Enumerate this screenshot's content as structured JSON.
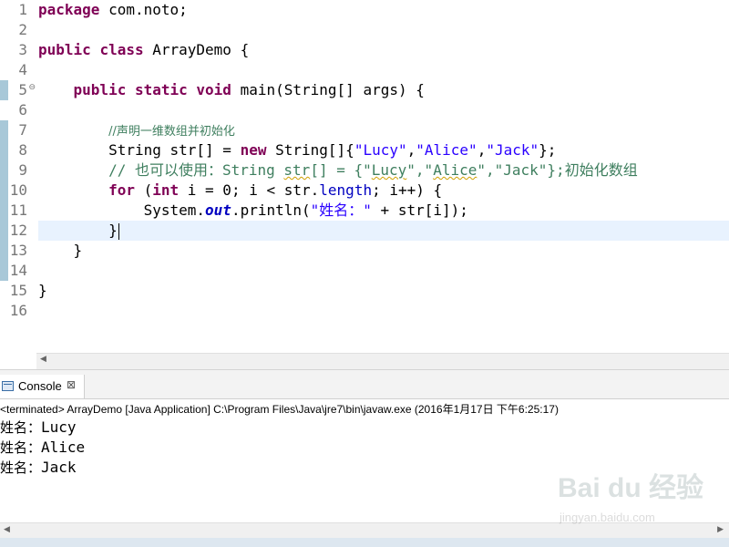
{
  "editor": {
    "line_numbers": [
      "1",
      "2",
      "3",
      "4",
      "5",
      "6",
      "7",
      "8",
      "9",
      "10",
      "11",
      "12",
      "13",
      "14",
      "15",
      "16"
    ],
    "lines": {
      "l1": {
        "kw": "package",
        "rest": " com.noto;"
      },
      "l3": {
        "kw1": "public",
        "kw2": "class",
        "rest": " ArrayDemo {"
      },
      "l5": {
        "indent": "    ",
        "kw1": "public",
        "kw2": "static",
        "kw3": "void",
        "rest": " main(String[] ",
        "param": "args",
        "end": ") {"
      },
      "l7": {
        "indent": "        ",
        "comment": "//声明一维数组并初始化"
      },
      "l8": {
        "indent": "        ",
        "a": "String ",
        "var": "str",
        "b": "[] = ",
        "kw": "new",
        "c": " String[]{",
        "s1": "\"Lucy\"",
        "comma1": ",",
        "s2": "\"Alice\"",
        "comma2": ",",
        "s3": "\"Jack\"",
        "end": "};"
      },
      "l9": {
        "indent": "        ",
        "c1": "// 也可以使用：String ",
        "var": "str",
        "c2": "[] = {\"",
        "w1": "Lucy",
        "c3": "\",\"",
        "w2": "Alice",
        "c4": "\",\"Jack\"};初始化数组"
      },
      "l10": {
        "indent": "        ",
        "kw1": "for",
        "a": " (",
        "kw2": "int",
        "b": " i = 0; i < ",
        "var": "str",
        "c": ".",
        "fld": "length",
        "d": "; i++) {"
      },
      "l11": {
        "indent": "            ",
        "a": "System.",
        "stat": "out",
        "b": ".println(",
        "str": "\"姓名：\"",
        "c": " + ",
        "var": "str",
        "d": "[i]);"
      },
      "l12": {
        "indent": "        ",
        "a": "}"
      },
      "l13": {
        "indent": "    ",
        "a": "}"
      },
      "l15": {
        "a": "}"
      }
    }
  },
  "console": {
    "tab_label": "Console",
    "close_symbol": "⊠",
    "status": "<terminated> ArrayDemo [Java Application] C:\\Program Files\\Java\\jre7\\bin\\javaw.exe (2016年1月17日 下午6:25:17)",
    "output": [
      {
        "label": "姓名：",
        "value": "Lucy"
      },
      {
        "label": "姓名：",
        "value": "Alice"
      },
      {
        "label": "姓名：",
        "value": "Jack"
      }
    ]
  },
  "watermark": {
    "logo": "Bai du 经验",
    "url": "jingyan.baidu.com"
  }
}
